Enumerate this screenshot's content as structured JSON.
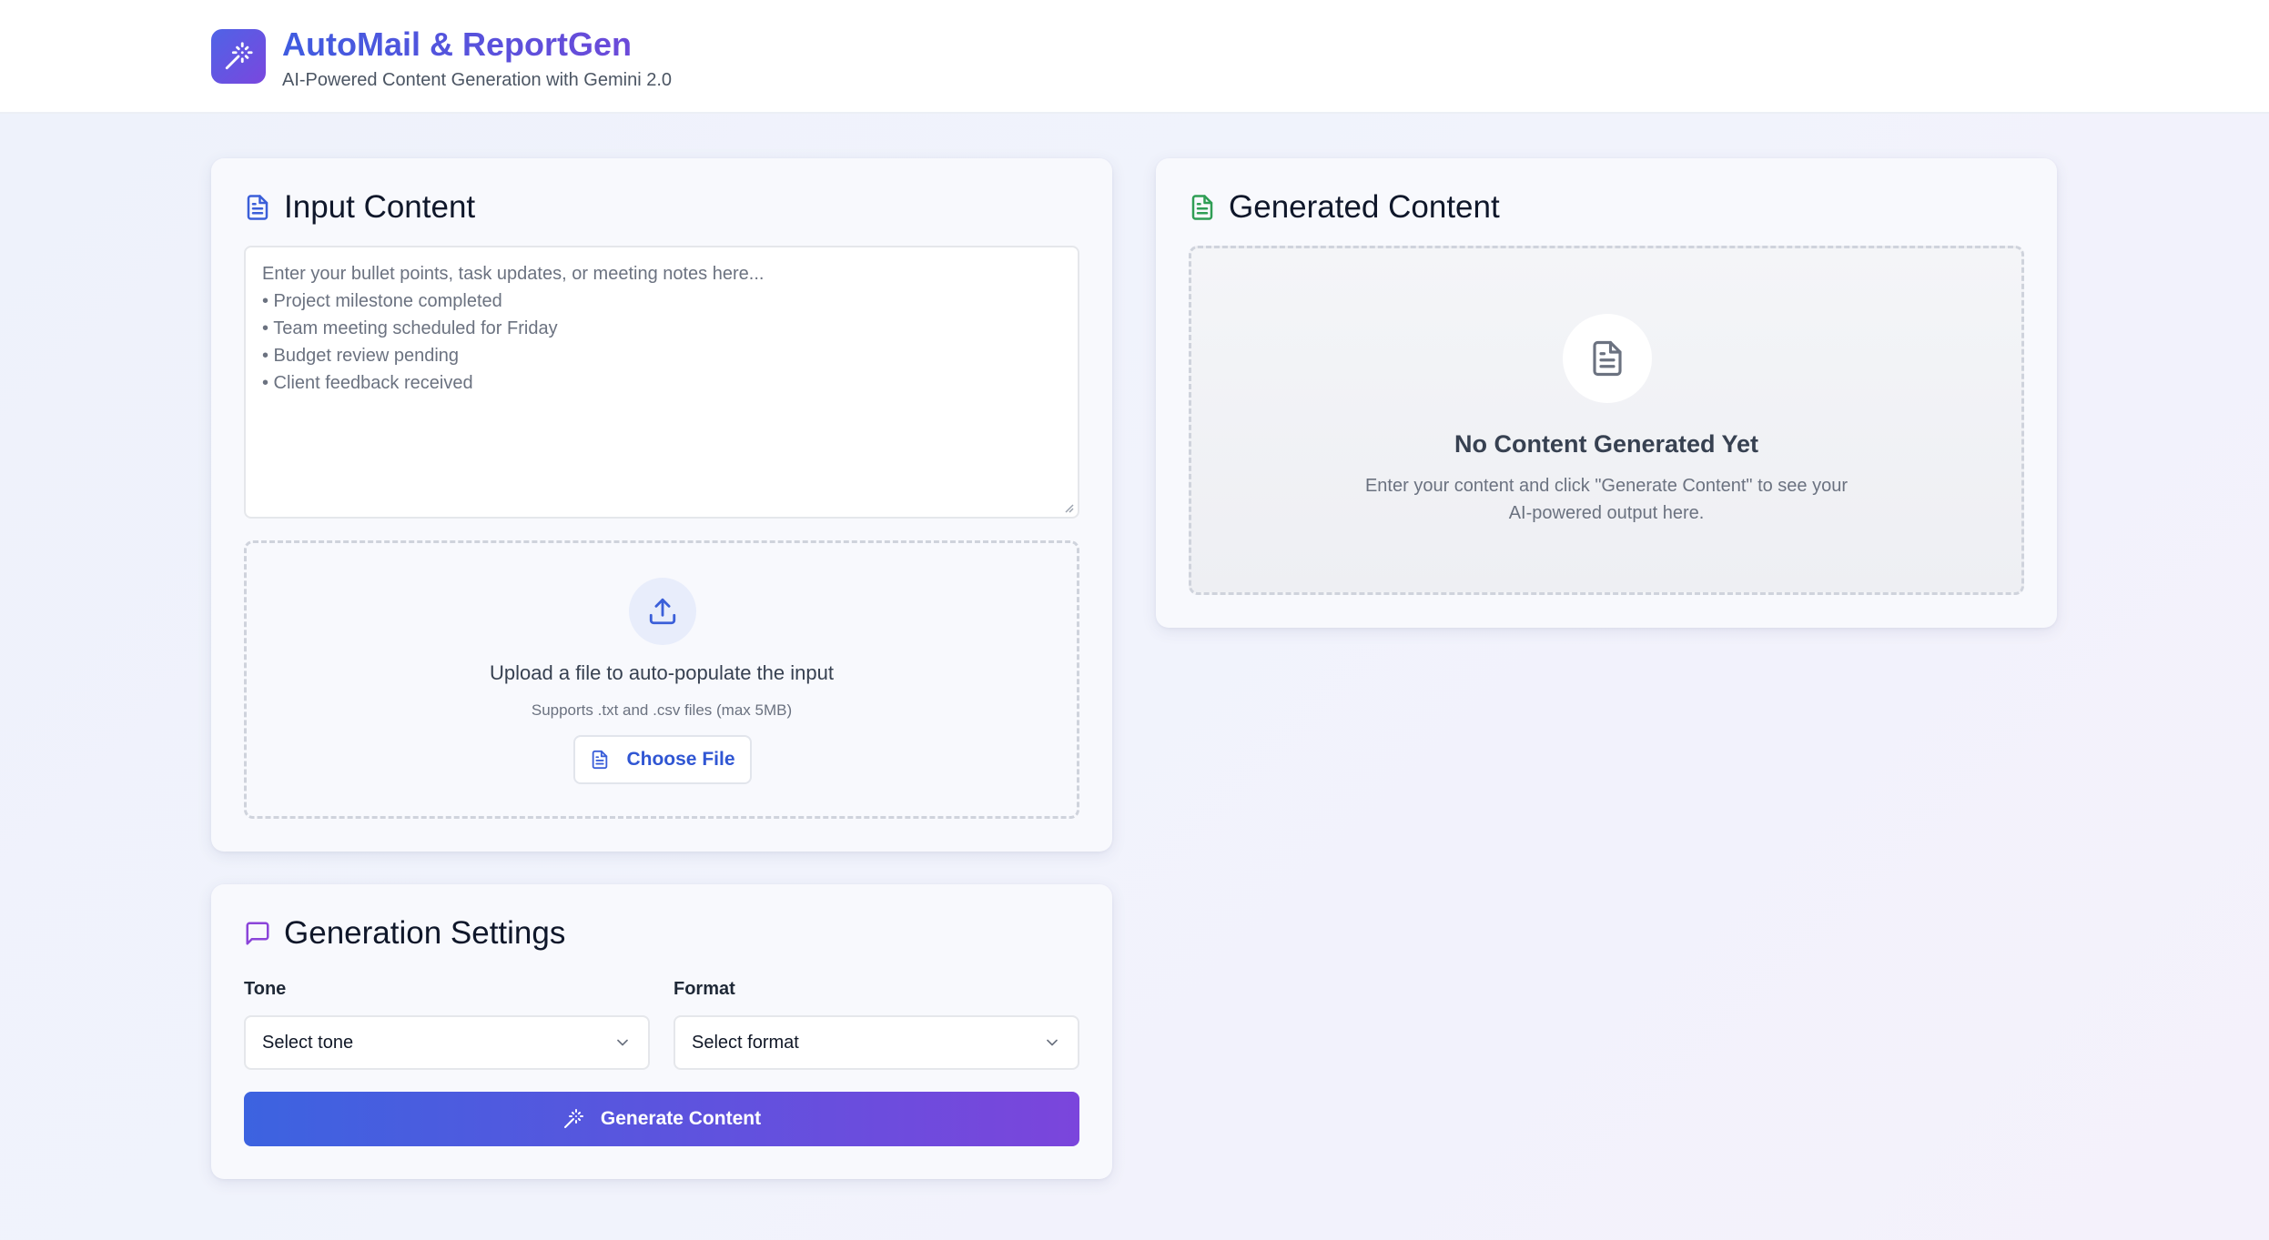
{
  "header": {
    "title": "AutoMail & ReportGen",
    "subtitle": "AI-Powered Content Generation with Gemini 2.0",
    "logo_icon": "magic-wand-icon"
  },
  "input_card": {
    "title": "Input Content",
    "title_icon": "document-icon",
    "textarea": {
      "placeholder_lines": [
        "Enter your bullet points, task updates, or meeting notes here...",
        "",
        "• Project milestone completed",
        "• Team meeting scheduled for Friday",
        "• Budget review pending",
        "• Client feedback received"
      ]
    },
    "upload": {
      "icon": "upload-icon",
      "title": "Upload a file to auto-populate the input",
      "hint": "Supports .txt and .csv files (max 5MB)",
      "button_label": "Choose File",
      "button_icon": "file-icon"
    }
  },
  "settings_card": {
    "title": "Generation Settings",
    "title_icon": "message-square-icon",
    "tone": {
      "label": "Tone",
      "value": "Select tone"
    },
    "format": {
      "label": "Format",
      "value": "Select format"
    },
    "generate_label": "Generate Content",
    "generate_icon": "magic-wand-icon"
  },
  "output_card": {
    "title": "Generated Content",
    "title_icon": "document-text-icon",
    "empty_icon": "document-icon",
    "empty_title": "No Content Generated Yet",
    "empty_desc_lines": [
      "Enter your content and click \"Generate Content\" to see your",
      "AI-powered output here."
    ]
  },
  "colors": {
    "brand_gradient_start": "#3c63e0",
    "brand_gradient_end": "#7b45dc",
    "input_title_icon": "#3b5fd9",
    "settings_title_icon": "#8b45d9",
    "output_title_icon": "#2f9e55"
  }
}
